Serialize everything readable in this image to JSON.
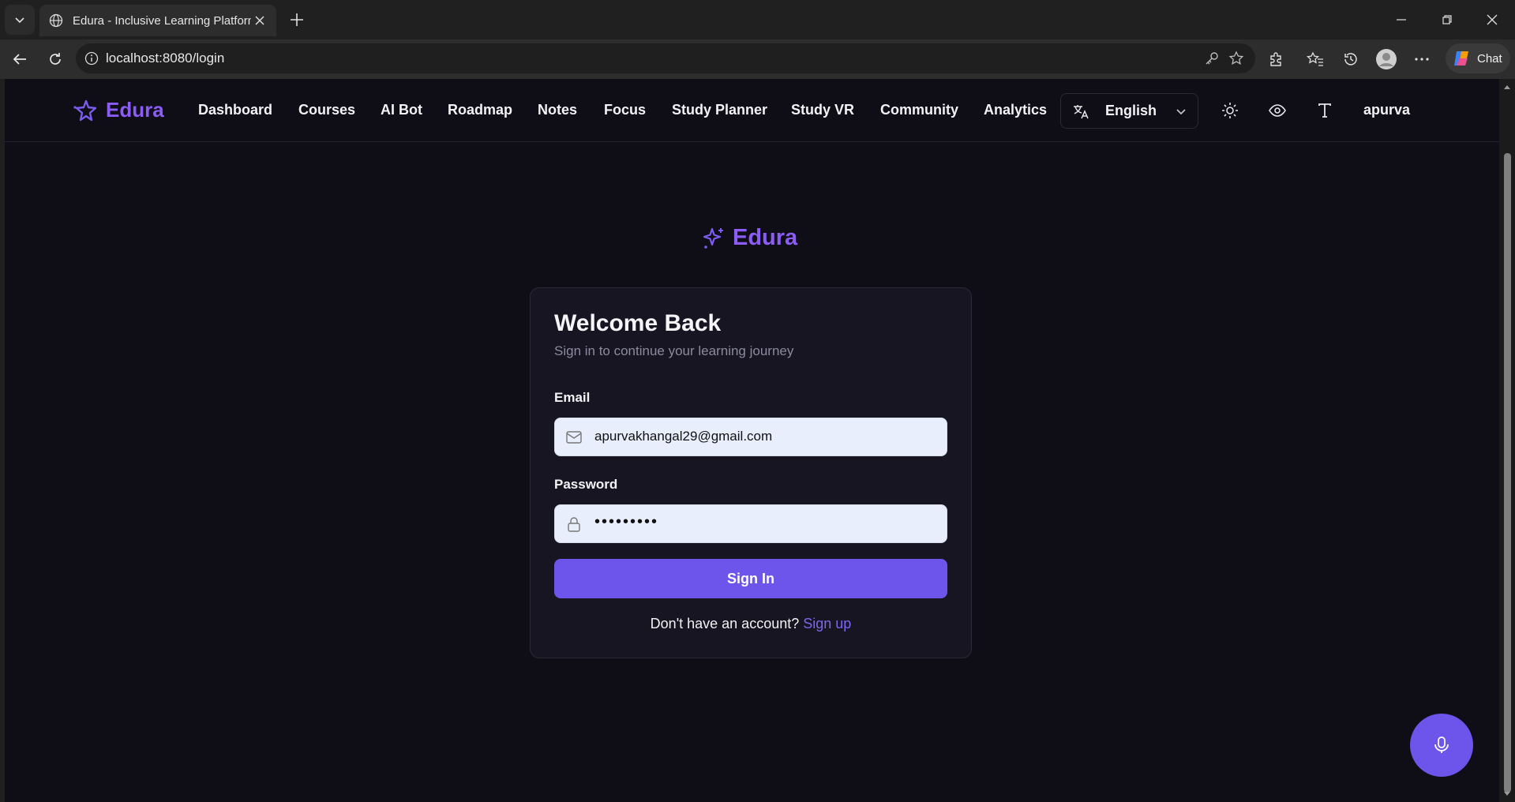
{
  "browser": {
    "tab_title": "Edura - Inclusive Learning Platform",
    "url": "localhost:8080/login",
    "chat_label": "Chat"
  },
  "nav": {
    "brand": "Edura",
    "links": [
      "Dashboard",
      "Courses",
      "AI Bot",
      "Roadmap",
      "Notes",
      "Focus",
      "Study Planner",
      "Study VR",
      "Community",
      "Analytics"
    ],
    "language": "English",
    "user": "apurva"
  },
  "login": {
    "brand": "Edura",
    "title": "Welcome Back",
    "subtitle": "Sign in to continue your learning journey",
    "email_label": "Email",
    "email_value": "apurvakhangal29@gmail.com",
    "password_label": "Password",
    "password_value": "•••••••••",
    "signin_label": "Sign In",
    "signup_prompt": "Don't have an account?",
    "signup_link": "Sign up"
  },
  "colors": {
    "brand": "#8b5cf6",
    "accent": "#6d54ea",
    "page_bg": "#0f0e17",
    "card_bg": "#161521"
  }
}
